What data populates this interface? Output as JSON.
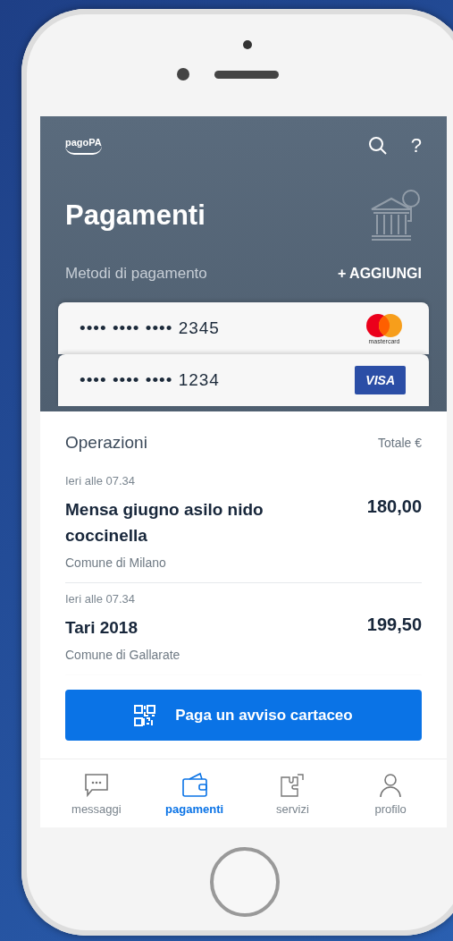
{
  "header": {
    "logo": "pagoPA",
    "help": "?",
    "title": "Pagamenti"
  },
  "payment_methods": {
    "label": "Metodi di pagamento",
    "add_button": "+ AGGIUNGI",
    "cards": [
      {
        "number": "•••• •••• •••• 2345",
        "kind": "mastercard",
        "brand": "mastercard"
      },
      {
        "number": "•••• •••• •••• 1234",
        "kind": "visa",
        "brand": "VISA"
      }
    ]
  },
  "operations": {
    "title": "Operazioni",
    "total_label": "Totale €",
    "rows": [
      {
        "date": "Ieri alle 07.34",
        "description": "Mensa giugno asilo nido coccinella",
        "amount": "180,00",
        "payee": "Comune di Milano"
      },
      {
        "date": "Ieri alle 07.34",
        "description": "Tari 2018",
        "amount": "199,50",
        "payee": "Comune di Gallarate"
      }
    ]
  },
  "pay_button": "Paga un avviso cartaceo",
  "tabs": [
    {
      "label": "messaggi",
      "kind": "messages",
      "selected": false
    },
    {
      "label": "pagamenti",
      "kind": "wallet",
      "selected": true
    },
    {
      "label": "servizi",
      "kind": "services",
      "selected": false
    },
    {
      "label": "profilo",
      "kind": "profile",
      "selected": false
    }
  ]
}
